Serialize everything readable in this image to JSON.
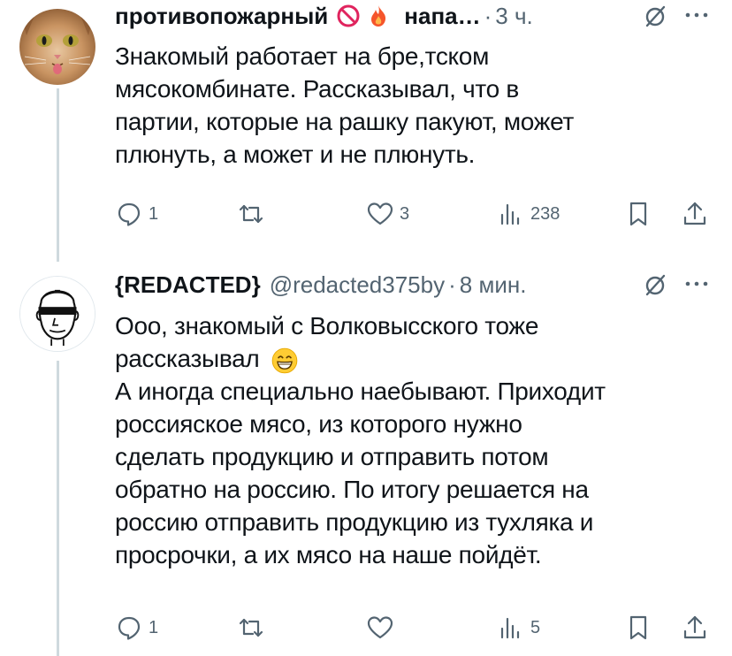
{
  "tweets": [
    {
      "author_name": "противопожарный",
      "author_name_tail": "напа…",
      "time": "3 ч.",
      "lines": [
        "Знакомый работает на бре,тском",
        "мясокомбинате. Рассказывал, что в",
        "партии, которые на рашку пакуют, может",
        "плюнуть, а может и не плюнуть."
      ],
      "replies": "1",
      "reposts": "",
      "likes": "3",
      "views": "238"
    },
    {
      "author_name": "{REDACTED}",
      "handle": "@redacted375by",
      "time": "8 мин.",
      "lines": [
        "Ооо, знакомый с Волковысского тоже",
        "рассказывал",
        "А иногда специально наебывают. Приходит",
        "россияское мясо, из которого нужно",
        "сделать продукцию и отправить потом",
        "обратно на россию. По итогу решается на",
        "россию отправить продукцию из тухляка и",
        "просрочки, а их мясо на наше пойдёт."
      ],
      "replies": "1",
      "reposts": "",
      "likes": "",
      "views": "5"
    }
  ],
  "colors": {
    "text": "#0f1419",
    "muted": "#536471",
    "thread_line": "#cfd9de",
    "background": "#ffffff"
  }
}
